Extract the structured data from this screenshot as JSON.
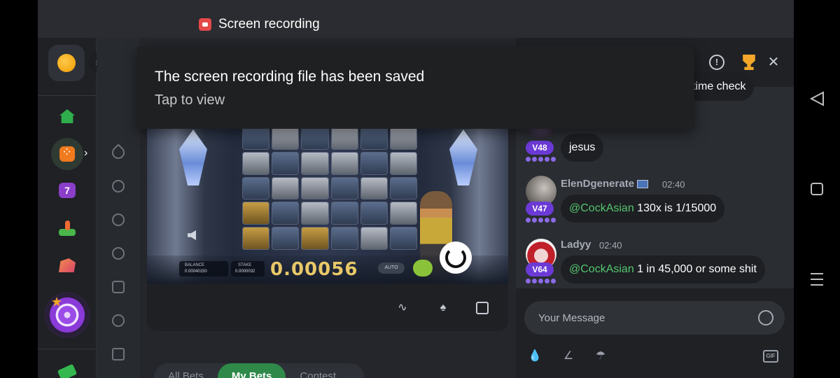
{
  "status_bar": {
    "recording_label": "Screen recording"
  },
  "notification": {
    "title": "The screen recording file has been saved",
    "subtitle": "Tap to view"
  },
  "sidebar": {
    "menu_icon": "≡",
    "items": [
      {
        "name": "home-icon"
      },
      {
        "name": "dice-icon"
      },
      {
        "name": "slots-seven-icon"
      },
      {
        "name": "joystick-icon"
      },
      {
        "name": "tickets-icon"
      },
      {
        "name": "featured-spiral-icon"
      },
      {
        "name": "green-ticket-icon"
      }
    ]
  },
  "game": {
    "hud": {
      "balance_label": "BALANCE",
      "balance_value": "0.00040150",
      "stake_label": "STAKE",
      "stake_value": "0.0000032",
      "win_display": "0.00056",
      "auto_label": "AUTO"
    },
    "toolbar": {
      "icons": [
        "graph-icon",
        "acorn-icon",
        "fullscreen-icon",
        "help-icon"
      ]
    }
  },
  "bets_tabs": [
    {
      "label": "All Bets",
      "active": false
    },
    {
      "label": "My Bets",
      "active": true
    },
    {
      "label": "Contest",
      "active": false
    }
  ],
  "chat": {
    "header_icons": [
      "info-icon",
      "trophy-icon",
      "close-icon"
    ],
    "partial_message": "time check",
    "messages": [
      {
        "vip": "V48",
        "text": "jesus"
      },
      {
        "username": "ElenDgenerate",
        "time": "02:40",
        "vip": "V47",
        "mention": "@CockAsian",
        "text": " 130x is 1/15000"
      },
      {
        "username": "Ladyy",
        "time": "02:40",
        "vip": "V64",
        "mention": "@CockAsian",
        "text": " 1 in 45,000 or some shit"
      }
    ],
    "input_placeholder": "Your Message",
    "footer_icons": [
      "drops-icon",
      "tip-icon",
      "rain-icon",
      "gif-icon"
    ],
    "gif_label": "GIF"
  },
  "colors": {
    "accent_green": "#2f8a4a",
    "vip_purple": "#6b3ad6",
    "mention_green": "#55c56e",
    "record_red": "#e54848"
  }
}
